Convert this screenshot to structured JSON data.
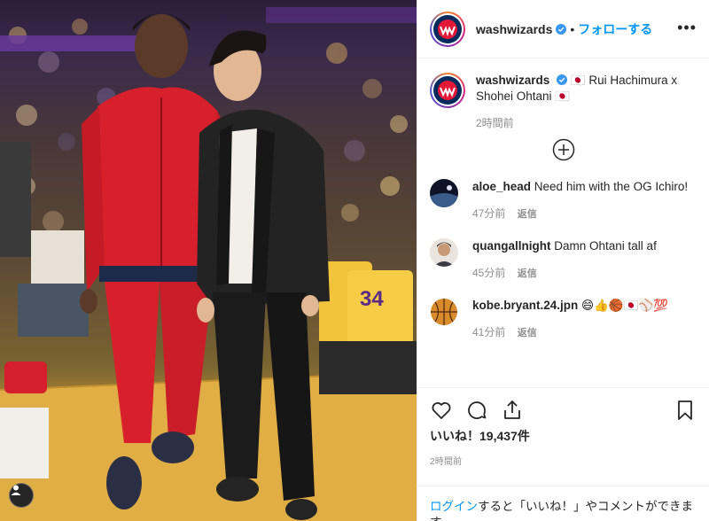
{
  "post": {
    "username": "washwizards",
    "follow_label": "フォローする",
    "separator": "•",
    "more_label": "•••"
  },
  "caption": {
    "username": "washwizards",
    "text": "🇯🇵 Rui Hachimura x Shohei Ohtani 🇯🇵",
    "time": "2時間前"
  },
  "comments": [
    {
      "username": "aloe_head",
      "text": "Need him with the OG Ichiro!",
      "time": "47分前",
      "reply": "返信"
    },
    {
      "username": "quangallnight",
      "text": "Damn Ohtani tall af",
      "time": "45分前",
      "reply": "返信"
    },
    {
      "username": "kobe.bryant.24.jpn",
      "text": "😄👍🏀🇯🇵⚾💯",
      "time": "41分前",
      "reply": "返信"
    }
  ],
  "actions": {
    "likes": "いいね！19,437件",
    "time": "2時間前"
  },
  "login": {
    "link": "ログイン",
    "text": "すると「いいね！」やコメントができます。"
  },
  "photo": {
    "jersey_number": "34"
  },
  "colors": {
    "accent": "#0095f6",
    "wizards_navy": "#002B5C",
    "wizards_red": "#E31837",
    "lakers_gold": "#FDB927"
  }
}
